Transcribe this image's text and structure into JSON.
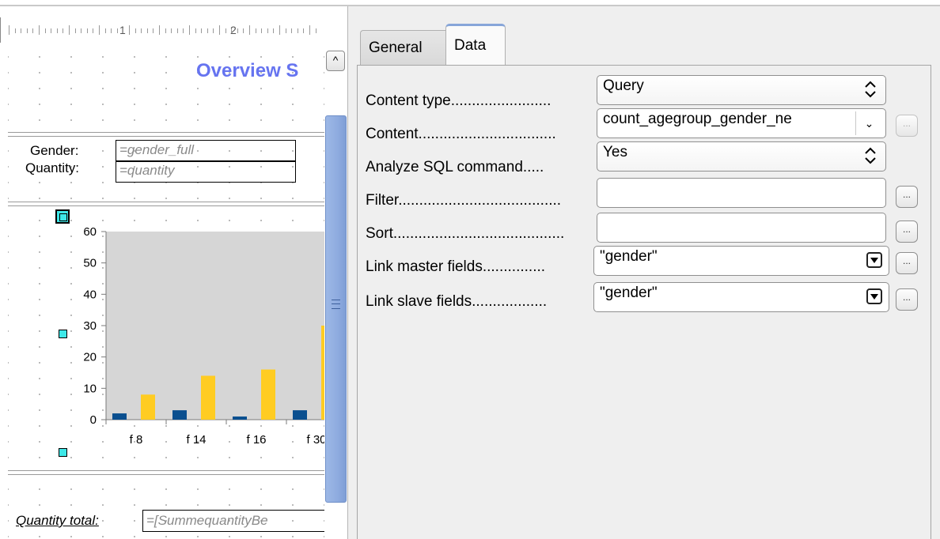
{
  "report": {
    "title": "Overview S",
    "ruler": {
      "mark1": "1",
      "mark2": "2"
    },
    "detail": {
      "gender_label": "Gender:",
      "gender_field": "=gender_full",
      "quantity_label": "Quantity:",
      "quantity_field": "=quantity"
    },
    "footer": {
      "total_label": "Quantity total:",
      "total_field": "=[SummequantityBe"
    }
  },
  "chart_data": {
    "type": "bar",
    "categories": [
      "f 8",
      "f 14",
      "f 16",
      "f 30"
    ],
    "series": [
      {
        "name": "",
        "color": "#0a4f8f",
        "values": [
          2,
          3,
          1,
          3
        ]
      },
      {
        "name": "",
        "color": "#ffcc22",
        "values": [
          8,
          14,
          16,
          30
        ]
      }
    ],
    "yticks": [
      "0",
      "10",
      "20",
      "30",
      "40",
      "50",
      "60"
    ],
    "ylim": [
      0,
      60
    ],
    "grid": false,
    "plot_background": "#d6d6d6"
  },
  "panel": {
    "tabs": [
      {
        "label": "General"
      },
      {
        "label": "Data",
        "active": true
      }
    ],
    "rows": {
      "content_type": {
        "label": "Content type",
        "dots": "........................",
        "value": "Query"
      },
      "content": {
        "label": "Content",
        "dots": ".................................",
        "value": "count_agegroup_gender_ne"
      },
      "analyze_sql": {
        "label": "Analyze SQL command",
        "dots": ".....",
        "value": "Yes"
      },
      "filter": {
        "label": "Filter",
        "dots": ".......................................",
        "value": ""
      },
      "sort": {
        "label": "Sort",
        "dots": ".........................................",
        "value": ""
      },
      "link_master": {
        "label": "Link master fields",
        "dots": "...............",
        "value": "\"gender\""
      },
      "link_slave": {
        "label": "Link slave fields",
        "dots": "..................",
        "value": "\"gender\""
      }
    },
    "ellipsis": "..."
  }
}
